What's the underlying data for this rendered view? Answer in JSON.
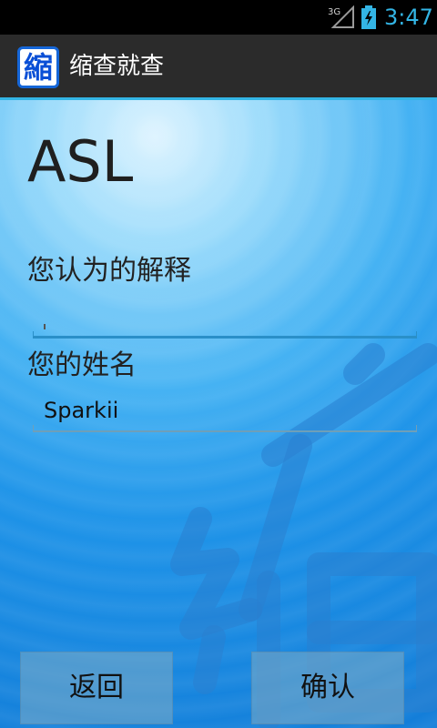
{
  "status_bar": {
    "network": "3G",
    "time": "3:47"
  },
  "action_bar": {
    "icon_glyph": "縮",
    "title": "缩查就查"
  },
  "form": {
    "term": "ASL",
    "explanation_label": "您认为的解释",
    "explanation_value": "",
    "name_label": "您的姓名",
    "name_value": "Sparkii"
  },
  "buttons": {
    "back_label": "返回",
    "confirm_label": "确认"
  },
  "colors": {
    "accent": "#33b5e5",
    "action_bar_bg": "#2b2b2b",
    "content_bg": "#1e93e8"
  },
  "icons": {
    "signal": "signal-3g-icon",
    "battery": "battery-charging-icon",
    "app": "app-logo-icon"
  }
}
